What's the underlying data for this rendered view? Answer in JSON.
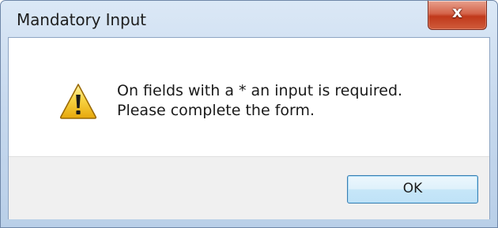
{
  "window": {
    "title": "Mandatory Input",
    "close_label": "x"
  },
  "dialog": {
    "icon": "warning-icon",
    "message_lines": [
      "On fields with a * an input is required.",
      "Please complete the form."
    ],
    "ok_label": "OK"
  },
  "colors": {
    "warning_fill": "#f2c21b",
    "close_button": "#c94a2c",
    "ok_border": "#3c7fb1"
  }
}
